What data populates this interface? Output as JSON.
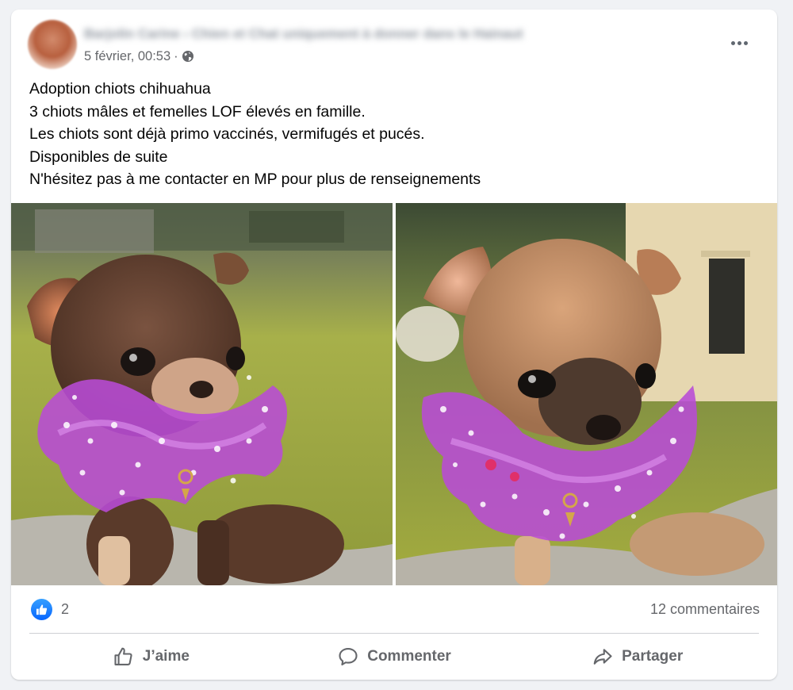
{
  "post": {
    "author_blurred": "Barjolin Carine › Chien et Chat uniquement à donner dans le Hainaut",
    "timestamp": "5 février, 00:53",
    "separator": "·",
    "audience_icon": "globe-icon",
    "menu_icon": "more-horizontal-icon",
    "text_lines": [
      "Adoption chiots chihuahua",
      "3 chiots mâles et femelles LOF élevés en famille.",
      "Les chiots sont déjà primo vaccinés, vermifugés et pucés.",
      "Disponibles de suite",
      "N'hésitez pas à me contacter en MP pour plus de renseignements"
    ],
    "photos": [
      {
        "icon": "chihuahua-puppy-photo"
      },
      {
        "icon": "chihuahua-puppy-photo"
      }
    ]
  },
  "stats": {
    "reactions_icon": "like-reaction-icon",
    "reactions_count": "2",
    "comments": "12 commentaires"
  },
  "actions": {
    "like": "J’aime",
    "comment": "Commenter",
    "share": "Partager"
  },
  "colors": {
    "background": "#f0f2f5",
    "card": "#ffffff",
    "text_secondary": "#65676b",
    "like_blue": "#0866ff",
    "collar_purple": "#b84bd6"
  }
}
